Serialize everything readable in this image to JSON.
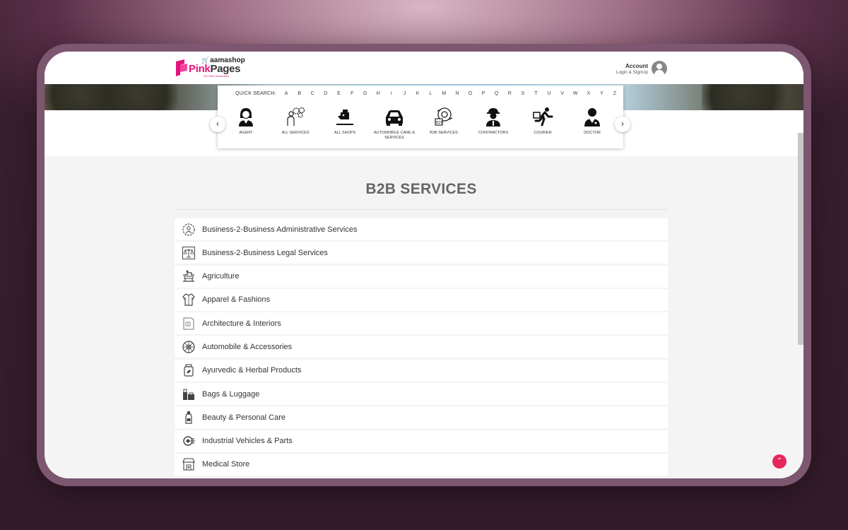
{
  "header": {
    "logo_top": "aamashop",
    "logo_main_prefix": "Pink",
    "logo_main_suffix": "Pages",
    "logo_tagline": "The Next Generation",
    "account_title": "Account",
    "account_sub": "Login & SignUp"
  },
  "quick_search": {
    "label": "QUICK SEARCH:",
    "letters": [
      "A",
      "B",
      "C",
      "D",
      "E",
      "F",
      "G",
      "H",
      "I",
      "J",
      "K",
      "L",
      "M",
      "N",
      "O",
      "P",
      "Q",
      "R",
      "S",
      "T",
      "U",
      "V",
      "W",
      "X",
      "Y",
      "Z"
    ]
  },
  "categories": [
    {
      "label": "AGENT",
      "icon": "agent-icon"
    },
    {
      "label": "ALL SERVICES",
      "icon": "services-icon"
    },
    {
      "label": "ALL SHOPS",
      "icon": "shop-icon"
    },
    {
      "label": "AUTOMOBILE CARE & SERVICES",
      "icon": "car-icon"
    },
    {
      "label": "B2B SERVICES",
      "icon": "b2b-icon"
    },
    {
      "label": "CONTRACTORS",
      "icon": "contractor-icon"
    },
    {
      "label": "COURIER",
      "icon": "courier-icon"
    },
    {
      "label": "DOCTOR",
      "icon": "doctor-icon"
    }
  ],
  "page": {
    "title": "B2B SERVICES",
    "items": [
      {
        "label": "Business-2-Business Administrative Services",
        "icon": "gear-person-icon"
      },
      {
        "label": "Business-2-Business Legal Services",
        "icon": "legal-scale-icon"
      },
      {
        "label": "Agriculture",
        "icon": "agriculture-icon"
      },
      {
        "label": "Apparel & Fashions",
        "icon": "shirt-icon"
      },
      {
        "label": "Architecture & Interiors",
        "icon": "blueprint-icon"
      },
      {
        "label": "Automobile & Accessories",
        "icon": "wheel-icon"
      },
      {
        "label": "Ayurvedic & Herbal Products",
        "icon": "herbal-jar-icon"
      },
      {
        "label": "Bags & Luggage",
        "icon": "luggage-icon"
      },
      {
        "label": "Beauty & Personal Care",
        "icon": "bottle-icon"
      },
      {
        "label": "Industrial Vehicles & Parts",
        "icon": "industrial-icon"
      },
      {
        "label": "Medical Store",
        "icon": "store-icon"
      }
    ]
  },
  "colors": {
    "brand_pink": "#e2137c",
    "scroll_top": "#e8265e"
  }
}
